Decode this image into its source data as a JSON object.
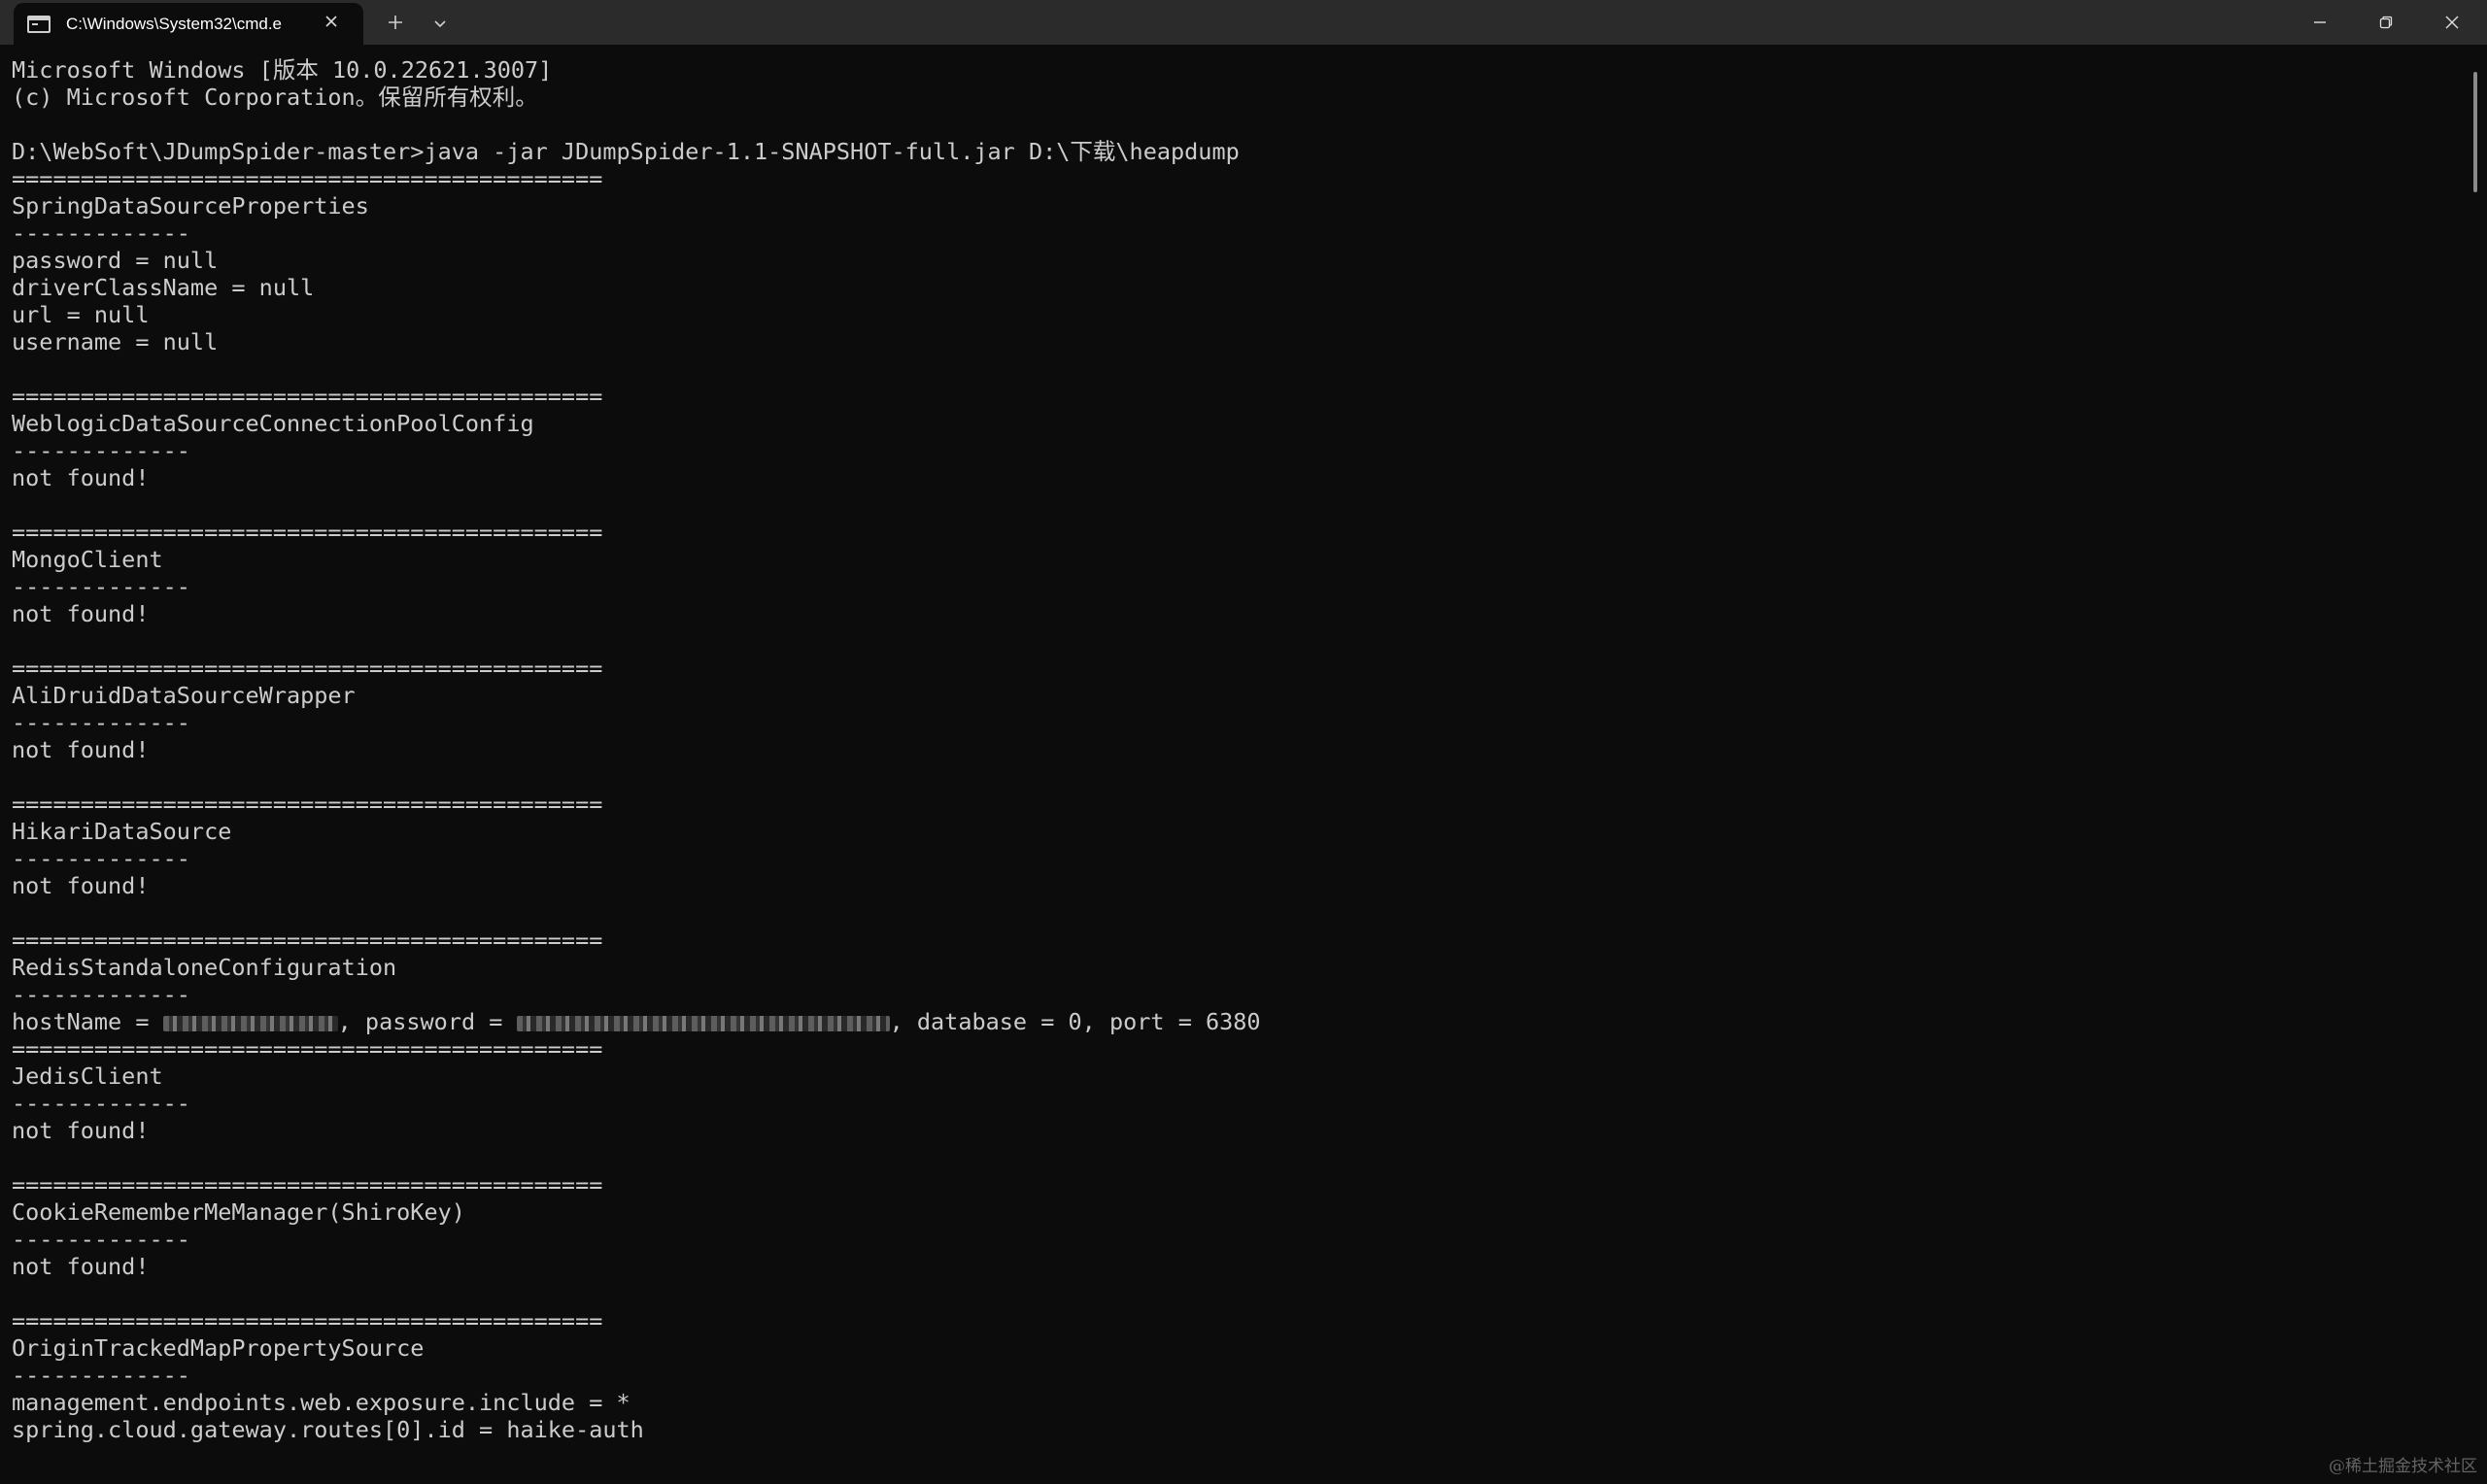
{
  "window": {
    "tab_title": "C:\\Windows\\System32\\cmd.e",
    "tab_close_icon": "close-icon",
    "new_tab_label": "+",
    "minimize_icon": "minimize-icon",
    "restore_icon": "restore-icon",
    "close_icon": "close-icon"
  },
  "terminal": {
    "lines": [
      "Microsoft Windows [版本 10.0.22621.3007]",
      "(c) Microsoft Corporation。保留所有权利。",
      "",
      "D:\\WebSoft\\JDumpSpider-master>java -jar JDumpSpider-1.1-SNAPSHOT-full.jar D:\\下载\\heapdump",
      "===========================================",
      "SpringDataSourceProperties",
      "-------------",
      "password = null",
      "driverClassName = null",
      "url = null",
      "username = null",
      "",
      "===========================================",
      "WeblogicDataSourceConnectionPoolConfig",
      "-------------",
      "not found!",
      "",
      "===========================================",
      "MongoClient",
      "-------------",
      "not found!",
      "",
      "===========================================",
      "AliDruidDataSourceWrapper",
      "-------------",
      "not found!",
      "",
      "===========================================",
      "HikariDataSource",
      "-------------",
      "not found!",
      "",
      "===========================================",
      "RedisStandaloneConfiguration",
      "-------------",
      "__REDIS__",
      "===========================================",
      "JedisClient",
      "-------------",
      "not found!",
      "",
      "===========================================",
      "CookieRememberMeManager(ShiroKey)",
      "-------------",
      "not found!",
      "",
      "===========================================",
      "OriginTrackedMapPropertySource",
      "-------------",
      "management.endpoints.web.exposure.include = *",
      "spring.cloud.gateway.routes[0].id = haike-auth"
    ],
    "redis_line": {
      "host_label": "hostName = ",
      "password_label": ", password = ",
      "tail": ", database = 0, port = 6380"
    }
  },
  "watermark": "@稀土掘金技术社区"
}
